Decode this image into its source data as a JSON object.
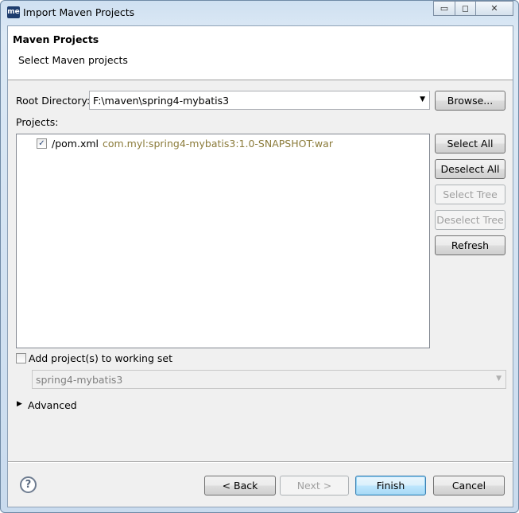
{
  "window": {
    "title": "Import Maven Projects",
    "app_icon": "me",
    "controls": {
      "minimize": "▭",
      "maximize": "◻",
      "close": "✕"
    }
  },
  "header": {
    "title": "Maven Projects",
    "description": "Select Maven projects"
  },
  "root_directory": {
    "label": "Root Directory:",
    "value": "F:\\maven\\spring4-mybatis3",
    "browse": "Browse..."
  },
  "projects": {
    "label": "Projects:",
    "items": [
      {
        "checked": true,
        "name": "/pom.xml",
        "coordinates": "com.myl:spring4-mybatis3:1.0-SNAPSHOT:war"
      }
    ]
  },
  "side_buttons": {
    "select_all": "Select All",
    "deselect_all": "Deselect All",
    "select_tree": "Select Tree",
    "deselect_tree": "Deselect Tree",
    "refresh": "Refresh"
  },
  "working_set": {
    "label": "Add project(s) to working set",
    "checked": false,
    "value": "spring4-mybatis3"
  },
  "advanced": {
    "label": "Advanced"
  },
  "footer": {
    "back": "< Back",
    "next": "Next >",
    "finish": "Finish",
    "cancel": "Cancel"
  },
  "colors": {
    "coordinates": "#8b7b3a",
    "accent": "#3c7fb1"
  }
}
